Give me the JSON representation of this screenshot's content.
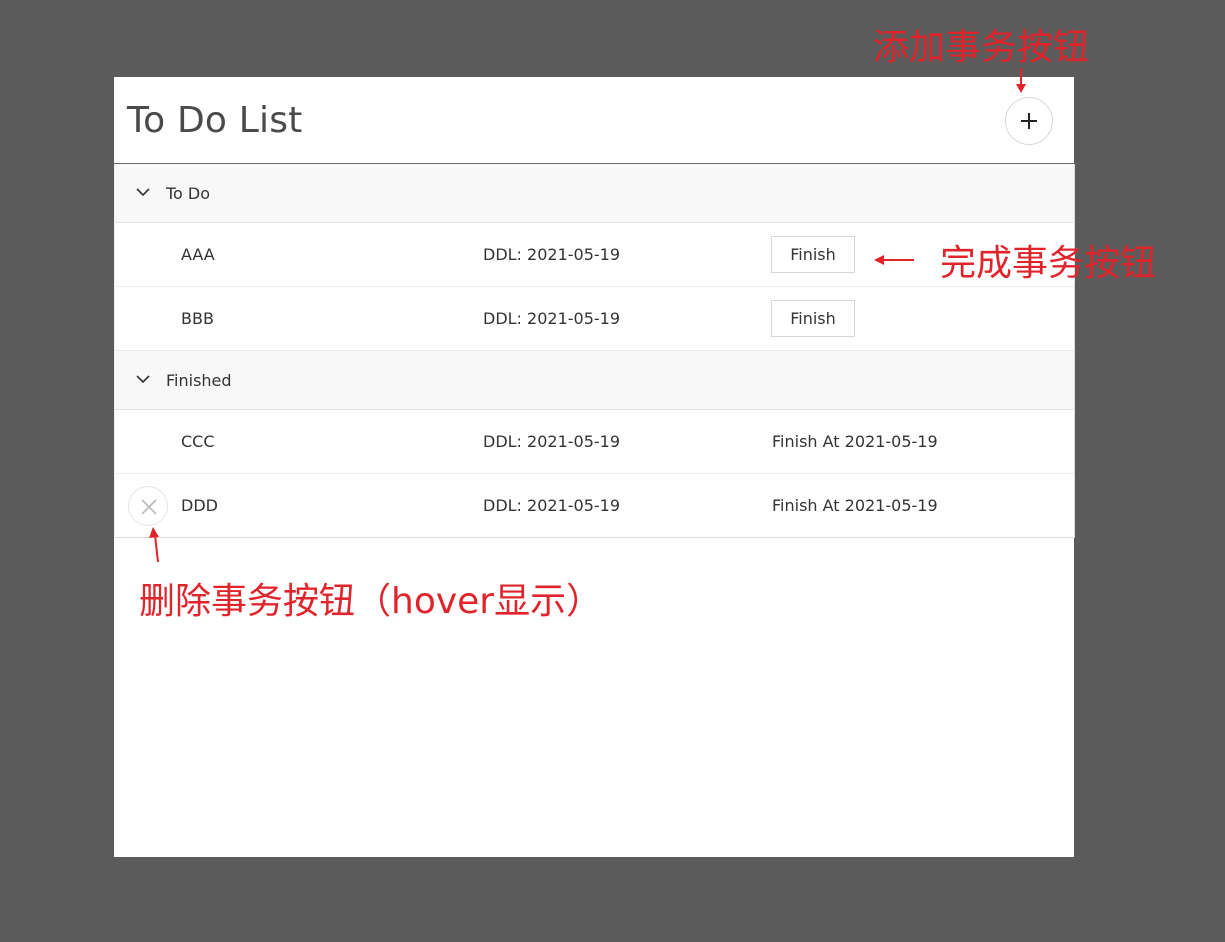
{
  "app": {
    "title": "To Do List",
    "add_button_label": "+"
  },
  "groups": [
    {
      "label": "To Do",
      "items": [
        {
          "name": "AAA",
          "ddl": "DDL: 2021-05-19",
          "action_label": "Finish"
        },
        {
          "name": "BBB",
          "ddl": "DDL: 2021-05-19",
          "action_label": "Finish"
        }
      ]
    },
    {
      "label": "Finished",
      "items": [
        {
          "name": "CCC",
          "ddl": "DDL: 2021-05-19",
          "finished_at": "Finish At 2021-05-19"
        },
        {
          "name": "DDD",
          "ddl": "DDL: 2021-05-19",
          "finished_at": "Finish At 2021-05-19"
        }
      ]
    }
  ],
  "annotations": {
    "add": "添加事务按钮",
    "finish": "完成事务按钮",
    "delete": "删除事务按钮（hover显示）"
  },
  "colors": {
    "backdrop": "#5b5b5b",
    "annotation": "#e0242c",
    "panel": "#ffffff"
  },
  "icons": {
    "add": "plus-icon",
    "group_toggle": "chevron-down-icon",
    "delete": "close-icon"
  }
}
